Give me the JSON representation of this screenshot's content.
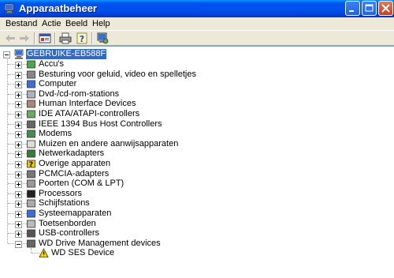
{
  "window": {
    "title": "Apparaatbeheer"
  },
  "menu": [
    "Bestand",
    "Actie",
    "Beeld",
    "Help"
  ],
  "toolbar": {
    "buttons": [
      "back-arrow-icon",
      "forward-arrow-icon",
      "properties-icon",
      "print-icon",
      "help-icon",
      "scan-hardware-icon"
    ]
  },
  "tree": {
    "root": "GEBRUIKE-EB588F",
    "categories": [
      {
        "label": "Accu's",
        "icon": "battery-icon"
      },
      {
        "label": "Besturing voor geluid, video en spelletjes",
        "icon": "sound-icon"
      },
      {
        "label": "Computer",
        "icon": "computer-icon"
      },
      {
        "label": "Dvd-/cd-rom-stations",
        "icon": "cdrom-icon"
      },
      {
        "label": "Human Interface Devices",
        "icon": "hid-icon"
      },
      {
        "label": "IDE ATA/ATAPI-controllers",
        "icon": "ide-icon"
      },
      {
        "label": "IEEE 1394 Bus Host Controllers",
        "icon": "firewire-icon"
      },
      {
        "label": "Modems",
        "icon": "modem-icon"
      },
      {
        "label": "Muizen en andere aanwijsapparaten",
        "icon": "mouse-icon"
      },
      {
        "label": "Netwerkadapters",
        "icon": "network-icon"
      },
      {
        "label": "Overige apparaten",
        "icon": "unknown-device-icon"
      },
      {
        "label": "PCMCIA-adapters",
        "icon": "pcmcia-icon"
      },
      {
        "label": "Poorten (COM & LPT)",
        "icon": "port-icon"
      },
      {
        "label": "Processors",
        "icon": "processor-icon"
      },
      {
        "label": "Schijfstations",
        "icon": "disk-drive-icon"
      },
      {
        "label": "Systeemapparaten",
        "icon": "system-device-icon"
      },
      {
        "label": "Toetsenborden",
        "icon": "keyboard-icon"
      },
      {
        "label": "USB-controllers",
        "icon": "usb-icon"
      },
      {
        "label": "WD Drive Management devices",
        "icon": "wd-device-icon",
        "expanded": true
      }
    ],
    "child": {
      "label": "WD SES Device",
      "icon": "warning-device-icon"
    }
  }
}
